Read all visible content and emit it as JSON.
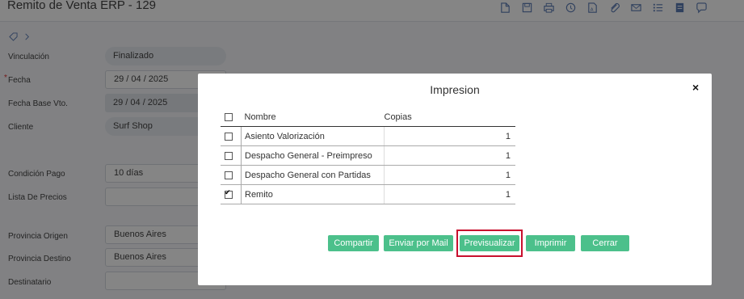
{
  "header": {
    "title": "Remito de Venta ERP - 129"
  },
  "toolbar": {
    "icons": [
      "export-icon",
      "save-icon",
      "print-icon",
      "history-icon",
      "pdf-icon",
      "attach-icon",
      "mail-icon",
      "list-icon",
      "notes-icon",
      "comment-icon"
    ]
  },
  "form": {
    "vinculacion": {
      "label": "Vinculación",
      "value": "Finalizado"
    },
    "fecha": {
      "label": "Fecha",
      "value": "29 / 04 / 2025",
      "required": "*"
    },
    "fecha_base": {
      "label": "Fecha Base Vto.",
      "value": "29 / 04 / 2025"
    },
    "cliente": {
      "label": "Cliente",
      "value": "Surf Shop"
    },
    "condicion": {
      "label": "Condición Pago",
      "value": "10 días"
    },
    "lista": {
      "label": "Lista De Precios",
      "value": ""
    },
    "prov_origen": {
      "label": "Provincia Origen",
      "value": "Buenos Aires"
    },
    "prov_destino": {
      "label": "Provincia Destino",
      "value": "Buenos Aires"
    },
    "destinatario": {
      "label": "Destinatario",
      "value": ""
    }
  },
  "modal": {
    "title": "Impresion",
    "close": "×",
    "columns": {
      "name": "Nombre",
      "copies": "Copias"
    },
    "rows": [
      {
        "name": "Asiento Valorización",
        "copies": "1",
        "checked": false
      },
      {
        "name": "Despacho General - Preimpreso",
        "copies": "1",
        "checked": false
      },
      {
        "name": "Despacho General con Partidas",
        "copies": "1",
        "checked": false
      },
      {
        "name": "Remito",
        "copies": "1",
        "checked": true
      }
    ],
    "buttons": {
      "compartir": "Compartir",
      "enviar": "Enviar por Mail",
      "previsualizar": "Previsualizar",
      "imprimir": "Imprimir",
      "cerrar": "Cerrar"
    }
  },
  "colors": {
    "accent": "#4cc08b",
    "highlight": "#c8102e"
  }
}
